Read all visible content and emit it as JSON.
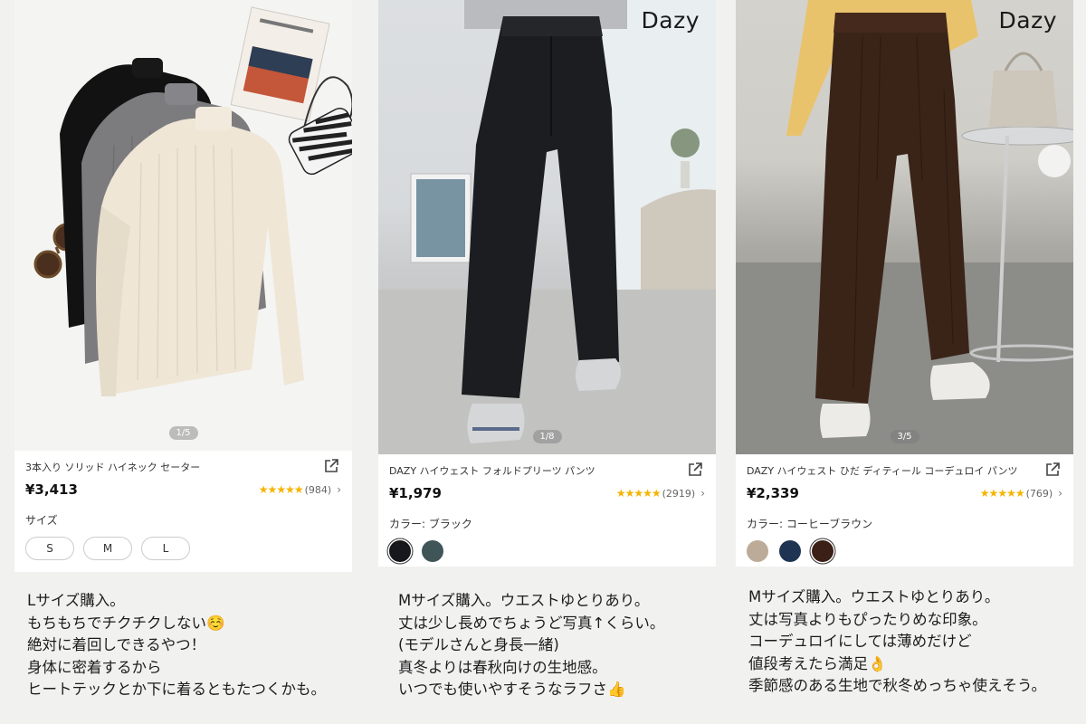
{
  "products": [
    {
      "title": "3本入り ソリッド ハイネック セーター",
      "price": "¥3,413",
      "rating_count": "(984)",
      "stars": "★★★★★",
      "counter": "1/5",
      "option_label": "サイズ",
      "sizes": [
        "S",
        "M",
        "L"
      ],
      "review": [
        "Lサイズ購入。",
        "もちもちでチクチクしない☺️",
        "絶対に着回しできるやつ！",
        "身体に密着するから",
        "ヒートテックとか下に着るともたつくかも。"
      ]
    },
    {
      "brand": "Dazy",
      "title": "DAZY ハイウェスト フォルドプリーツ パンツ",
      "price": "¥1,979",
      "rating_count": "(2919)",
      "stars": "★★★★★",
      "counter": "1/8",
      "option_label": "カラー: ブラック",
      "swatches": [
        "#16181b",
        "#3f5558"
      ],
      "review": [
        "Mサイズ購入。ウエストゆとりあり。",
        "丈は少し長めでちょうど写真↑くらい。",
        "(モデルさんと身長一緒)",
        "真冬よりは春秋向けの生地感。",
        "いつでも使いやすそうなラフさ👍"
      ]
    },
    {
      "brand": "Dazy",
      "title": "DAZY ハイウェスト ひだ ディティール コーデュロイ パンツ",
      "price": "¥2,339",
      "rating_count": "(769)",
      "stars": "★★★★★",
      "counter": "3/5",
      "option_label": "カラー: コーヒーブラウン",
      "swatches": [
        "#bcab98",
        "#1f3352",
        "#3b2018"
      ],
      "review": [
        "Mサイズ購入。ウエストゆとりあり。",
        "丈は写真よりもぴったりめな印象。",
        "コーデュロイにしては薄めだけど",
        "値段考えたら満足👌",
        "季節感のある生地で秋冬めっちゃ使えそう。"
      ]
    }
  ],
  "colors": {
    "star": "#f5b400",
    "card_bg": "#ffffff",
    "page_bg": "#f1f1f0"
  }
}
